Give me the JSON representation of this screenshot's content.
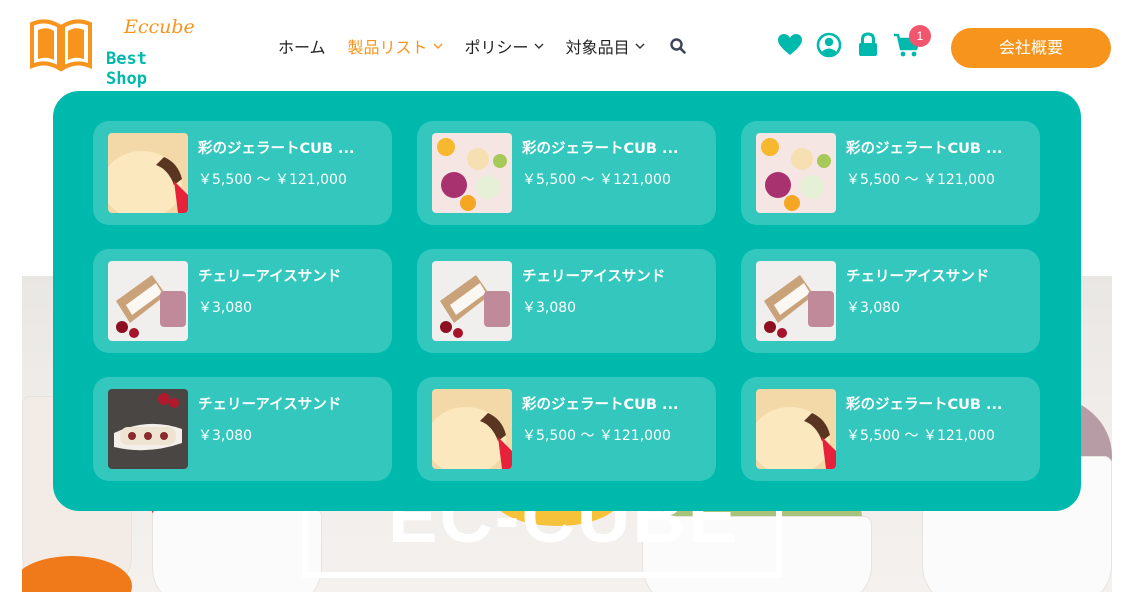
{
  "header": {
    "logo": {
      "script": "Eccube",
      "name": "Best Shop"
    },
    "nav": [
      {
        "label": "ホーム",
        "has_dropdown": false,
        "active": false
      },
      {
        "label": "製品リスト",
        "has_dropdown": true,
        "active": true
      },
      {
        "label": "ポリシー",
        "has_dropdown": true,
        "active": false
      },
      {
        "label": "対象品目",
        "has_dropdown": true,
        "active": false
      }
    ],
    "icons": [
      "search-icon",
      "heart-icon",
      "user-icon",
      "lock-icon",
      "cart-icon"
    ],
    "cart_count": "1",
    "company_button": "会社概要"
  },
  "hero": {
    "word": "EC-CUBE"
  },
  "mega_menu": {
    "products": [
      {
        "title": "彩のジェラートCUB ...",
        "price": "￥5,500 〜 ￥121,000",
        "image": "gelato-scoop"
      },
      {
        "title": "彩のジェラートCUB ...",
        "price": "￥5,500 〜 ￥121,000",
        "image": "gelato-cups"
      },
      {
        "title": "彩のジェラートCUB ...",
        "price": "￥5,500 〜 ￥121,000",
        "image": "gelato-cups"
      },
      {
        "title": "チェリーアイスサンド",
        "price": "￥3,080",
        "image": "ice-sandwich"
      },
      {
        "title": "チェリーアイスサンド",
        "price": "￥3,080",
        "image": "ice-sandwich"
      },
      {
        "title": "チェリーアイスサンド",
        "price": "￥3,080",
        "image": "ice-sandwich"
      },
      {
        "title": "チェリーアイスサンド",
        "price": "￥3,080",
        "image": "ice-roll"
      },
      {
        "title": "彩のジェラートCUB ...",
        "price": "￥5,500 〜 ￥121,000",
        "image": "gelato-scoop"
      },
      {
        "title": "彩のジェラートCUB ...",
        "price": "￥5,500 〜 ￥121,000",
        "image": "gelato-scoop"
      }
    ]
  },
  "colors": {
    "accent": "#f7941d",
    "brand": "#00b9ad",
    "badge": "#f2566f"
  }
}
